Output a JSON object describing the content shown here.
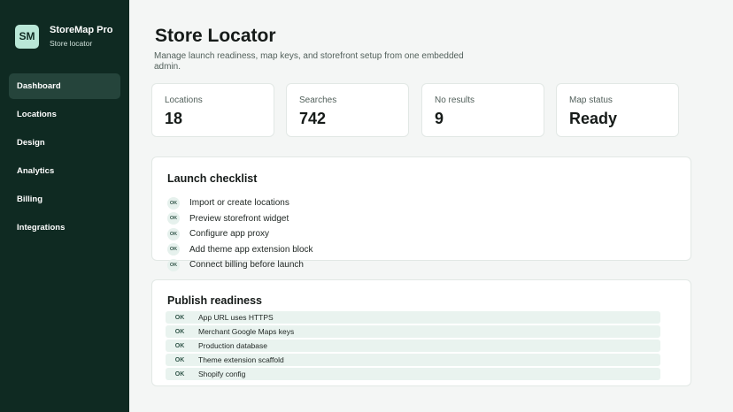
{
  "brand": {
    "logo": "SM",
    "name": "StoreMap Pro",
    "subtitle": "Store locator"
  },
  "nav": [
    {
      "label": "Dashboard",
      "active": true
    },
    {
      "label": "Locations",
      "active": false
    },
    {
      "label": "Design",
      "active": false
    },
    {
      "label": "Analytics",
      "active": false
    },
    {
      "label": "Billing",
      "active": false
    },
    {
      "label": "Integrations",
      "active": false
    }
  ],
  "page": {
    "title": "Store Locator",
    "description": "Manage launch readiness, map keys, and storefront setup from one embedded admin."
  },
  "stats": [
    {
      "label": "Locations",
      "value": "18"
    },
    {
      "label": "Searches",
      "value": "742"
    },
    {
      "label": "No results",
      "value": "9"
    },
    {
      "label": "Map status",
      "value": "Ready"
    }
  ],
  "checklist": {
    "title": "Launch checklist",
    "items": [
      {
        "badge": "OK",
        "text": "Import or create locations"
      },
      {
        "badge": "OK",
        "text": "Preview storefront widget"
      },
      {
        "badge": "OK",
        "text": "Configure app proxy"
      },
      {
        "badge": "OK",
        "text": "Add theme app extension block"
      },
      {
        "badge": "OK",
        "text": "Connect billing before launch"
      }
    ]
  },
  "readiness": {
    "title": "Publish readiness",
    "items": [
      {
        "badge": "OK",
        "text": "App URL uses HTTPS"
      },
      {
        "badge": "OK",
        "text": "Merchant Google Maps keys"
      },
      {
        "badge": "OK",
        "text": "Production database"
      },
      {
        "badge": "OK",
        "text": "Theme extension scaffold"
      },
      {
        "badge": "OK",
        "text": "Shopify config"
      }
    ]
  },
  "colors": {
    "sidebar": "#0f2a22",
    "nav_active": "#25443b",
    "logo_bg": "#b9e7d7",
    "ok_bg": "#e6f1ed",
    "ready_row_bg": "#e9f3ef"
  }
}
